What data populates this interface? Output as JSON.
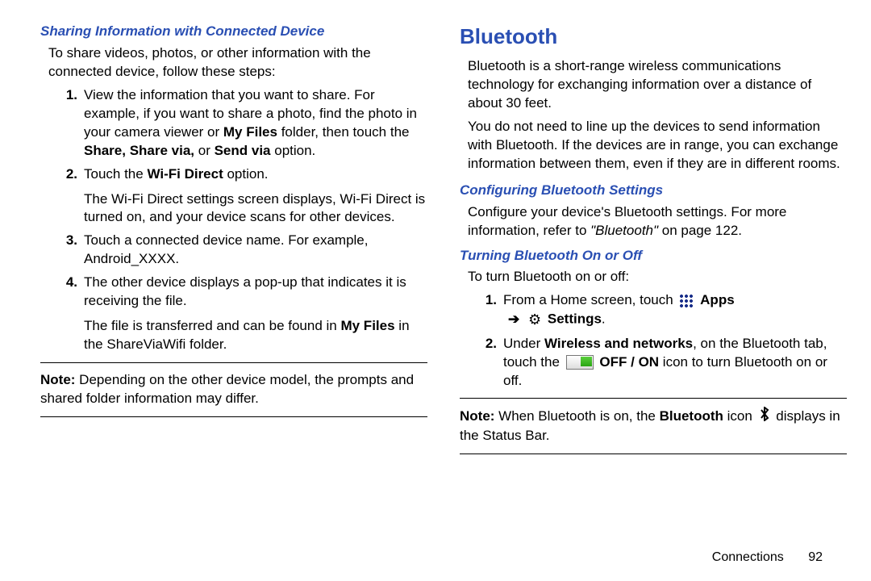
{
  "left": {
    "headingA": "Sharing Information with Connected Device",
    "intro": "To share videos, photos, or other information with the connected device, follow these steps:",
    "steps": [
      {
        "num": "1.",
        "text_parts": [
          "View the information that you want to share. For example, if you want to share a photo, find the photo in your camera viewer or ",
          "My Files",
          " folder, then touch the ",
          "Share, Share via,",
          " or ",
          "Send via",
          " option."
        ],
        "extra": []
      },
      {
        "num": "2.",
        "text_parts": [
          "Touch the ",
          "Wi-Fi Direct",
          " option."
        ],
        "extra": [
          "The Wi-Fi Direct settings screen displays, Wi-Fi Direct is turned on, and your device scans for other devices."
        ]
      },
      {
        "num": "3.",
        "text_parts": [
          "Touch a connected device name. For example, Android_XXXX."
        ],
        "extra": []
      },
      {
        "num": "4.",
        "text_parts": [
          "The other device displays a pop-up that indicates it is receiving the file."
        ],
        "extra_rich": {
          "pre": "The file is transferred and can be found in ",
          "bold": "My Files",
          "post": " in the ShareViaWifi folder."
        }
      }
    ],
    "note_label": "Note:",
    "note_text": " Depending on the other device model, the prompts and shared folder information may differ."
  },
  "right": {
    "section": "Bluetooth",
    "p1": "Bluetooth is a short-range wireless communications technology for exchanging information over a distance of about 30 feet.",
    "p2": "You do not need to line up the devices to send information with Bluetooth. If the devices are in range, you can exchange information between them, even if they are in different rooms.",
    "headingB": "Configuring Bluetooth Settings",
    "configure_pre": "Configure your device's Bluetooth settings. For more information, refer to ",
    "configure_ref": "\"Bluetooth\"",
    "configure_post": " on page 122.",
    "headingC": "Turning Bluetooth On or Off",
    "turn_intro": "To turn Bluetooth on or off:",
    "turn_steps": {
      "s1_pre": "From a Home screen, touch ",
      "s1_apps": "Apps",
      "s1_settings": "Settings",
      "s1_period": ".",
      "s2_pre": "Under ",
      "s2_wan": "Wireless and networks",
      "s2_mid": ", on the Bluetooth tab, touch the ",
      "s2_offon": "OFF / ON",
      "s2_post": " icon to turn Bluetooth on or off."
    },
    "note2_label": "Note:",
    "note2_pre": " When Bluetooth is on, the ",
    "note2_bold": "Bluetooth",
    "note2_mid": " icon ",
    "note2_post": " displays in the Status Bar."
  },
  "footer": {
    "section_name": "Connections",
    "page_number": "92"
  },
  "nums": {
    "one": "1.",
    "two": "2."
  }
}
